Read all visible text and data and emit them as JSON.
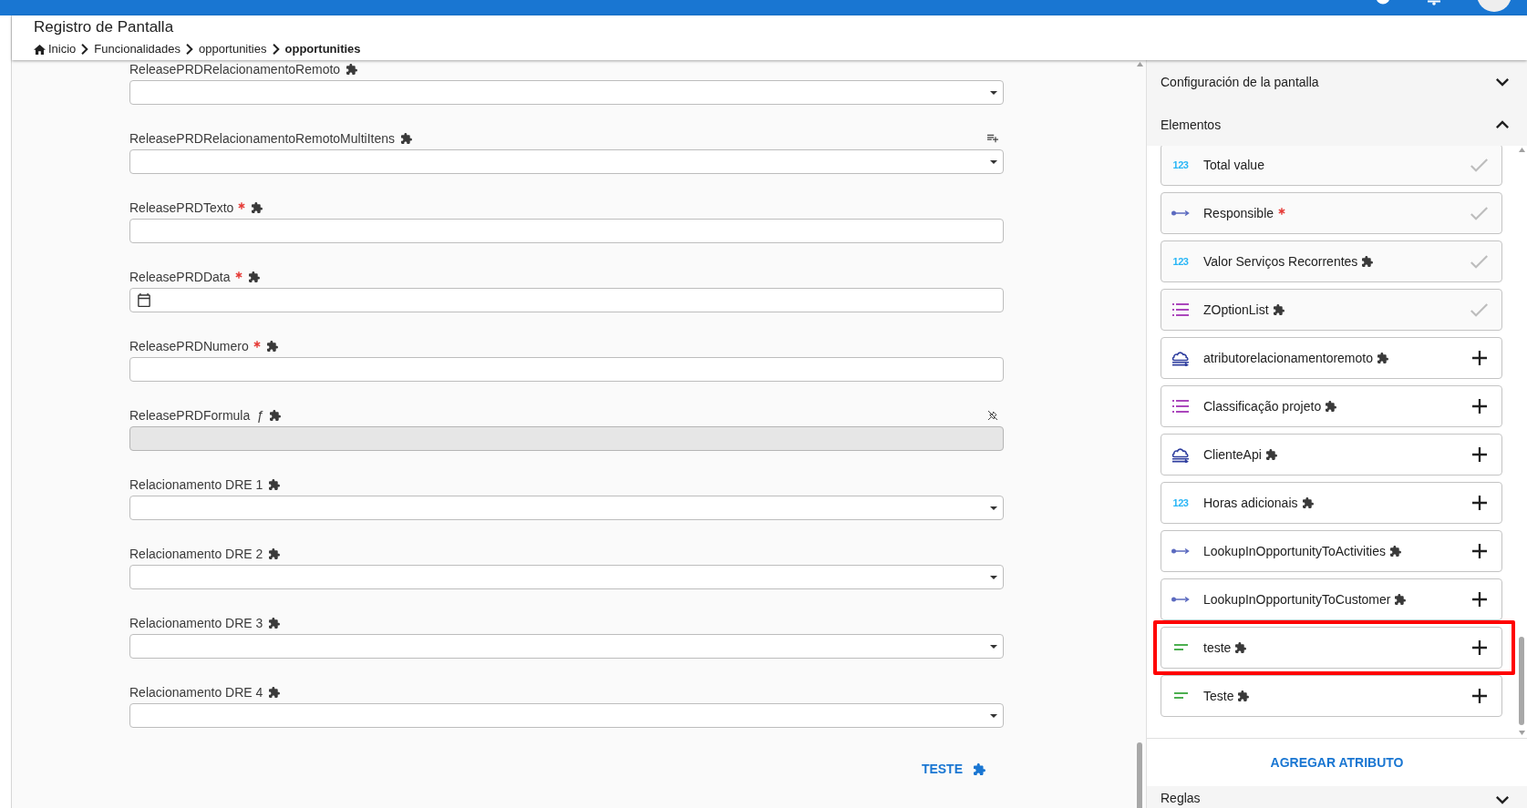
{
  "header": {
    "title": "Registro de Pantalla",
    "breadcrumb": [
      {
        "label": "Inicio",
        "kind": "home",
        "current": false
      },
      {
        "label": "Funcionalidades",
        "kind": "link",
        "current": false
      },
      {
        "label": "opportunities",
        "kind": "link",
        "current": false
      },
      {
        "label": "opportunities",
        "kind": "link",
        "current": true
      }
    ]
  },
  "form": {
    "fields": [
      {
        "label": "ReleasePRDRelacionamentoRemoto",
        "kind": "select",
        "required": false,
        "custom": true,
        "disabled": false
      },
      {
        "label": "ReleasePRDRelacionamentoRemotoMultiItens",
        "kind": "multiselect",
        "required": false,
        "custom": true,
        "disabled": false
      },
      {
        "label": "ReleasePRDTexto",
        "kind": "text",
        "required": true,
        "custom": true,
        "disabled": false
      },
      {
        "label": "ReleasePRDData",
        "kind": "date",
        "required": true,
        "custom": true,
        "disabled": false
      },
      {
        "label": "ReleasePRDNumero",
        "kind": "number",
        "required": true,
        "custom": true,
        "disabled": false
      },
      {
        "label": "ReleasePRDFormula",
        "kind": "formula",
        "symbol": "ƒ",
        "required": false,
        "custom": true,
        "disabled": true
      },
      {
        "label": "Relacionamento DRE 1",
        "kind": "select",
        "required": false,
        "custom": true,
        "disabled": false
      },
      {
        "label": "Relacionamento DRE 2",
        "kind": "select",
        "required": false,
        "custom": true,
        "disabled": false
      },
      {
        "label": "Relacionamento DRE 3",
        "kind": "select",
        "required": false,
        "custom": true,
        "disabled": false
      },
      {
        "label": "Relacionamento DRE 4",
        "kind": "select",
        "required": false,
        "custom": true,
        "disabled": false
      }
    ],
    "action": {
      "label": "TESTE",
      "custom": true
    }
  },
  "panel": {
    "sections": [
      {
        "title": "Configuración de la pantalla",
        "expanded": false
      },
      {
        "title": "Elementos",
        "expanded": true,
        "items": [
          {
            "name": "Total value",
            "kind": "number",
            "glyph": "123",
            "required": false,
            "custom": false,
            "added": true,
            "highlighted": false
          },
          {
            "name": "Responsible",
            "kind": "lookup",
            "required": true,
            "custom": false,
            "added": true,
            "highlighted": false
          },
          {
            "name": "Valor Serviços Recorrentes",
            "kind": "number",
            "glyph": "123",
            "required": false,
            "custom": true,
            "added": true,
            "highlighted": false
          },
          {
            "name": "ZOptionList",
            "kind": "list",
            "required": false,
            "custom": true,
            "added": true,
            "highlighted": false
          },
          {
            "name": "atributorelacionamentoremoto",
            "kind": "remote",
            "required": false,
            "custom": true,
            "added": false,
            "highlighted": false
          },
          {
            "name": "Classificação projeto",
            "kind": "list",
            "required": false,
            "custom": true,
            "added": false,
            "highlighted": false
          },
          {
            "name": "ClienteApi",
            "kind": "remote",
            "required": false,
            "custom": true,
            "added": false,
            "highlighted": false
          },
          {
            "name": "Horas adicionais",
            "kind": "number",
            "glyph": "123",
            "required": false,
            "custom": true,
            "added": false,
            "highlighted": false
          },
          {
            "name": "LookupInOpportunityToActivities",
            "kind": "lookup",
            "required": false,
            "custom": true,
            "added": false,
            "highlighted": false
          },
          {
            "name": "LookupInOpportunityToCustomer",
            "kind": "lookup",
            "required": false,
            "custom": true,
            "added": false,
            "highlighted": false
          },
          {
            "name": "teste",
            "kind": "text",
            "required": false,
            "custom": true,
            "added": false,
            "highlighted": true
          },
          {
            "name": "Teste",
            "kind": "text",
            "required": false,
            "custom": true,
            "added": false,
            "highlighted": false
          }
        ],
        "add_button": "AGREGAR ATRIBUTO"
      },
      {
        "title": "Reglas",
        "expanded": false
      }
    ]
  }
}
